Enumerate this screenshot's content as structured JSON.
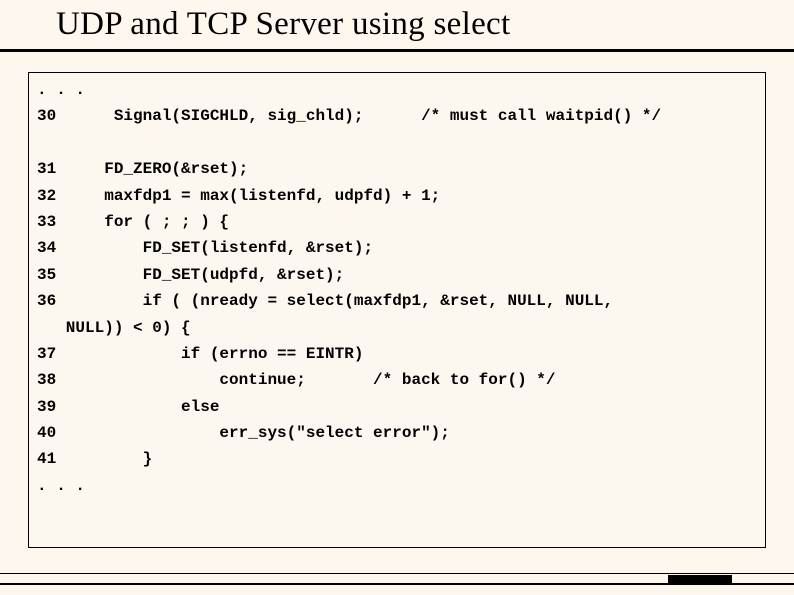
{
  "title": "UDP and TCP Server using select",
  "code_lines": [
    ". . .",
    "30      Signal(SIGCHLD, sig_chld);      /* must call waitpid() */",
    "",
    "31     FD_ZERO(&rset);",
    "32     maxfdp1 = max(listenfd, udpfd) + 1;",
    "33     for ( ; ; ) {",
    "34         FD_SET(listenfd, &rset);",
    "35         FD_SET(udpfd, &rset);",
    "36         if ( (nready = select(maxfdp1, &rset, NULL, NULL,",
    "   NULL)) < 0) {",
    "37             if (errno == EINTR)",
    "38                 continue;       /* back to for() */",
    "39             else",
    "40                 err_sys(\"select error\");",
    "41         }",
    ". . ."
  ]
}
